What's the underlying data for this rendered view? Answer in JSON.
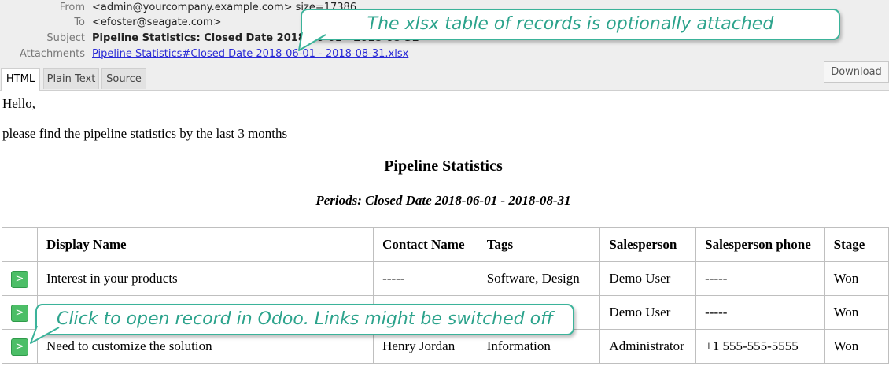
{
  "email": {
    "from_label": "From",
    "from_value": "<admin@yourcompany.example.com> size=17386",
    "to_label": "To",
    "to_value": "<efoster@seagate.com>",
    "subject_label": "Subject",
    "subject_value": "Pipeline Statistics: Closed Date 2018-06-01 - 2018-08-31",
    "attachments_label": "Attachments",
    "attachment_name": "Pipeline Statistics#Closed Date 2018-06-01 - 2018-08-31.xlsx"
  },
  "tabs": [
    "HTML",
    "Plain Text",
    "Source"
  ],
  "download_label": "Download",
  "body": {
    "greeting": "Hello,",
    "intro": "please find the pipeline statistics by the last 3 months",
    "title": "Pipeline Statistics",
    "period": "Periods: Closed Date 2018-06-01 - 2018-08-31"
  },
  "table": {
    "headers": [
      "",
      "Display Name",
      "Contact Name",
      "Tags",
      "Salesperson",
      "Salesperson phone",
      "Stage"
    ],
    "button_label": ">",
    "rows": [
      [
        "Interest in your products",
        "-----",
        "Software, Design",
        "Demo User",
        "-----",
        "Won"
      ],
      [
        "",
        "",
        "",
        "Demo User",
        "-----",
        "Won"
      ],
      [
        "Need to customize the solution",
        "Henry Jordan",
        "Information",
        "Administrator",
        "+1 555-555-5555",
        "Won"
      ]
    ]
  },
  "callouts": {
    "top": "The xlsx table of records is optionally attached",
    "bottom": "Click to open record in Odoo. Links might be switched off"
  },
  "colors": {
    "callout_border": "#3bb39a",
    "callout_text": "#2ca38c",
    "button_green": "#4cbe67",
    "link_blue": "#2a2ad6"
  }
}
